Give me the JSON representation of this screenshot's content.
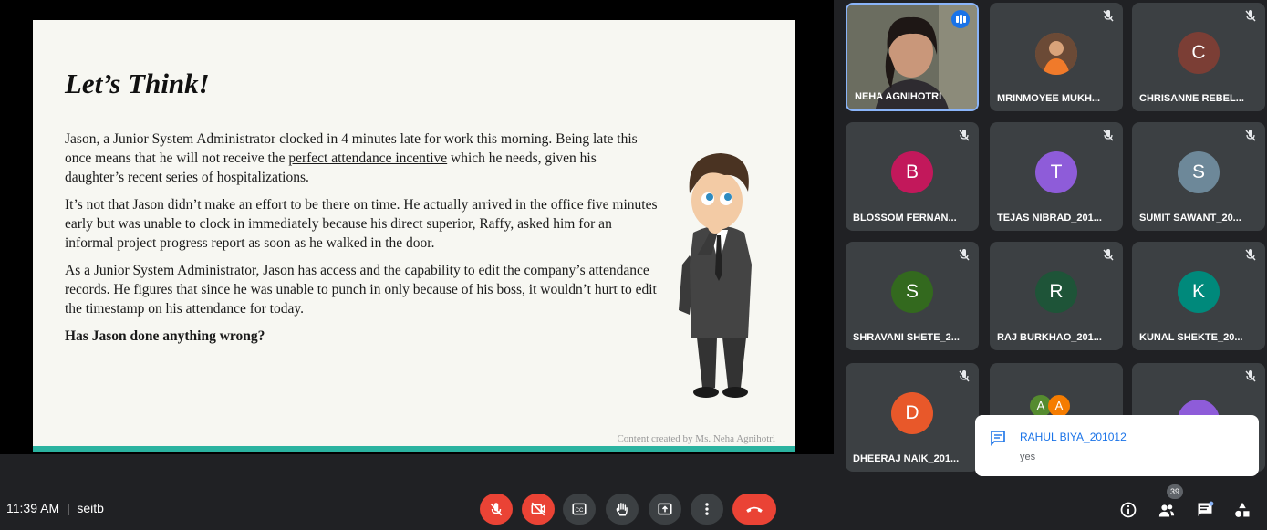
{
  "slide": {
    "title": "Let’s Think!",
    "p1_a": "Jason, a Junior System Administrator clocked in 4 minutes late for work this morning. Being late this once means that he will not receive the ",
    "p1_link": "perfect attendance incentive",
    "p1_b": " which he needs, given his daughter’s recent series of hospitalizations.",
    "p2": "It’s not that Jason didn’t make an effort to be there on time. He actually arrived in the office five minutes early but was unable to clock in immediately because his direct superior, Raffy, asked him for an informal project progress report as soon as he walked in the door.",
    "p3": "As a Junior System Administrator, Jason has access and the capability to edit the company’s attendance records. He figures that since he was unable to punch in only because of his boss, it wouldn’t hurt to edit the timestamp on his attendance for today.",
    "question": "Has Jason done anything wrong?",
    "credit": "Content created by Ms. Neha Agnihotri",
    "accent_color": "#2bb3a0"
  },
  "participants": [
    {
      "name": "NEHA AGNIHOTRI",
      "speaking": true
    },
    {
      "name": "MRINMOYEE MUKH...",
      "photo": true,
      "muted": true
    },
    {
      "name": "CHRISANNE REBEL...",
      "initial": "C",
      "color": "#7b3e35",
      "muted": true
    },
    {
      "name": "BLOSSOM FERNAN...",
      "initial": "B",
      "color": "#c2185b",
      "muted": true
    },
    {
      "name": "TEJAS NIBRAD_201...",
      "initial": "T",
      "color": "#8e5cd9",
      "muted": true
    },
    {
      "name": "SUMIT SAWANT_20...",
      "initial": "S",
      "color": "#6d8899",
      "muted": true
    },
    {
      "name": "SHRAVANI SHETE_2...",
      "initial": "S",
      "color": "#33691e",
      "muted": true
    },
    {
      "name": "RAJ BURKHAO_201...",
      "initial": "R",
      "color": "#1e5438",
      "muted": true
    },
    {
      "name": "KUNAL SHEKTE_20...",
      "initial": "K",
      "color": "#00897b",
      "muted": true
    },
    {
      "name": "DHEERAJ NAIK_201...",
      "initial": "D",
      "color": "#e8582a",
      "muted": true
    }
  ],
  "group_tile": {
    "initials": [
      "A",
      "A"
    ],
    "colors": [
      "#558b2f",
      "#f57c00"
    ]
  },
  "chat_popup": {
    "sender": "RAHUL BIYA_201012",
    "message": "yes"
  },
  "meeting": {
    "time": "11:39 AM",
    "separator": "|",
    "code": "seitb"
  },
  "controls": [
    "mic-off",
    "camera-off",
    "captions",
    "raise-hand",
    "present",
    "more-options",
    "leave-call"
  ],
  "side_controls": {
    "people_count": "39"
  }
}
